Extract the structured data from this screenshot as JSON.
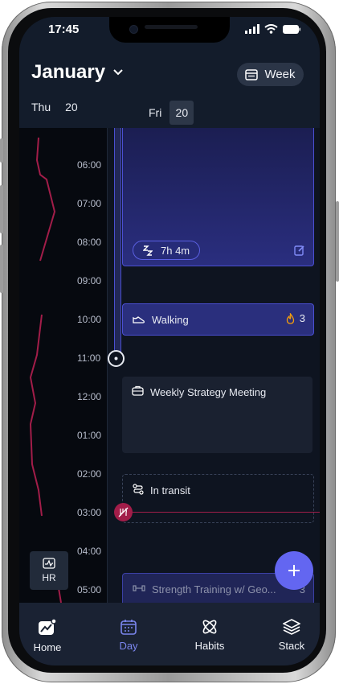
{
  "status": {
    "time": "17:45"
  },
  "header": {
    "month": "January",
    "view_label": "Week",
    "days": [
      {
        "name": "Thu",
        "num": "20"
      },
      {
        "name": "Fri",
        "num": "20"
      }
    ]
  },
  "timeline": {
    "hours": [
      "06:00",
      "07:00",
      "08:00",
      "09:00",
      "10:00",
      "11:00",
      "12:00",
      "01:00",
      "02:00",
      "03:00",
      "04:00",
      "05:00"
    ]
  },
  "events": {
    "sleep": {
      "duration": "7h 4m"
    },
    "walking": {
      "title": "Walking",
      "count": "3"
    },
    "meeting": {
      "title": "Weekly Strategy Meeting"
    },
    "transit": {
      "title": "In transit"
    },
    "strength": {
      "title": "Strength Training w/ Geo...",
      "count": "3"
    }
  },
  "hr_button": {
    "label": "HR"
  },
  "tabs": [
    {
      "label": "Home",
      "icon": "home-chart-icon"
    },
    {
      "label": "Day",
      "icon": "calendar-icon"
    },
    {
      "label": "Habits",
      "icon": "atom-icon"
    },
    {
      "label": "Stack",
      "icon": "layers-icon"
    }
  ],
  "colors": {
    "accent": "#6366f1",
    "hr_line": "#a21d49",
    "bg": "#0e1420"
  }
}
